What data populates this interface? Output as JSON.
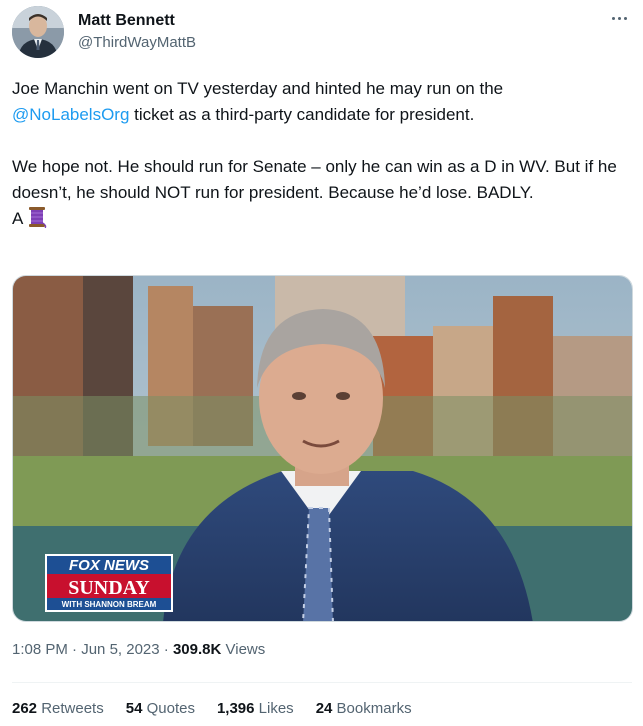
{
  "author": {
    "name": "Matt Bennett",
    "handle": "@ThirdWayMattB"
  },
  "tweet": {
    "line1_pre": "Joe Manchin went on TV yesterday and hinted he may run on the",
    "mention": "@NoLabelsOrg",
    "line1_post": " ticket as a third-party candidate for president.",
    "para2": "We hope not. He should run for Senate – only he can win as a D in WV. But if he doesn’t, he should NOT run for president. Because he’d lose. BADLY.",
    "signoff": "A"
  },
  "media": {
    "logo_top": "FOX NEWS",
    "logo_mid": "SUNDAY",
    "logo_bottom": "WITH SHANNON BREAM"
  },
  "meta": {
    "time": "1:08 PM",
    "sep1": " · ",
    "date": "Jun 5, 2023",
    "sep2": " · ",
    "views_count": "309.8K",
    "views_label": " Views"
  },
  "stats": {
    "retweets_count": "262",
    "retweets_label": " Retweets",
    "quotes_count": "54",
    "quotes_label": " Quotes",
    "likes_count": "1,396",
    "likes_label": " Likes",
    "bookmarks_count": "24",
    "bookmarks_label": " Bookmarks"
  }
}
